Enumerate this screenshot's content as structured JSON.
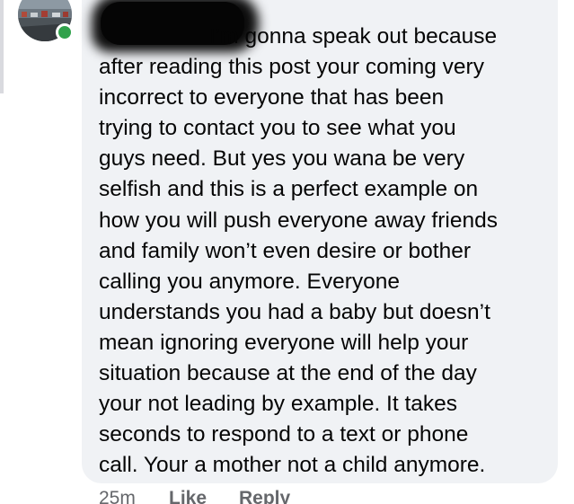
{
  "comment": {
    "author_redacted": true,
    "author_online": true,
    "text": "I’m gonna speak out because after reading this post your coming very incorrect to everyone that has been trying to contact you to see what you guys need. But yes you wana be very selfish and this is a perfect example on how you will push everyone away friends and family won’t even desire or bother calling you anymore. Everyone understands you had a baby but doesn’t mean ignoring everyone will help your situation because at the end of the day your not leading by example. It takes seconds to respond to a text or phone call. Your a mother not a child anymore.",
    "lines": [
      "I’m gonna speak out because",
      "after reading this post your coming very",
      "incorrect to everyone that has been",
      "trying to contact you to see what you",
      "guys need. But yes you wana be very",
      "selfish and this is a perfect example on",
      "how you will push everyone away friends",
      "and family won’t even desire or bother",
      "calling you anymore. Everyone",
      "understands you had a baby but doesn’t",
      "mean ignoring everyone will help your",
      "situation because at the end of the day",
      "your not leading by example. It takes",
      "seconds to respond to a text or phone",
      "call. Your a mother not a child anymore."
    ],
    "timestamp": "25m",
    "like_label": "Like",
    "reply_label": "Reply"
  },
  "colors": {
    "bubble_bg": "#f0f2f5",
    "text": "#050505",
    "meta_text": "#65676b",
    "online_green": "#31a24c"
  },
  "icons": {
    "avatar": "profile-photo",
    "presence": "online-dot"
  }
}
